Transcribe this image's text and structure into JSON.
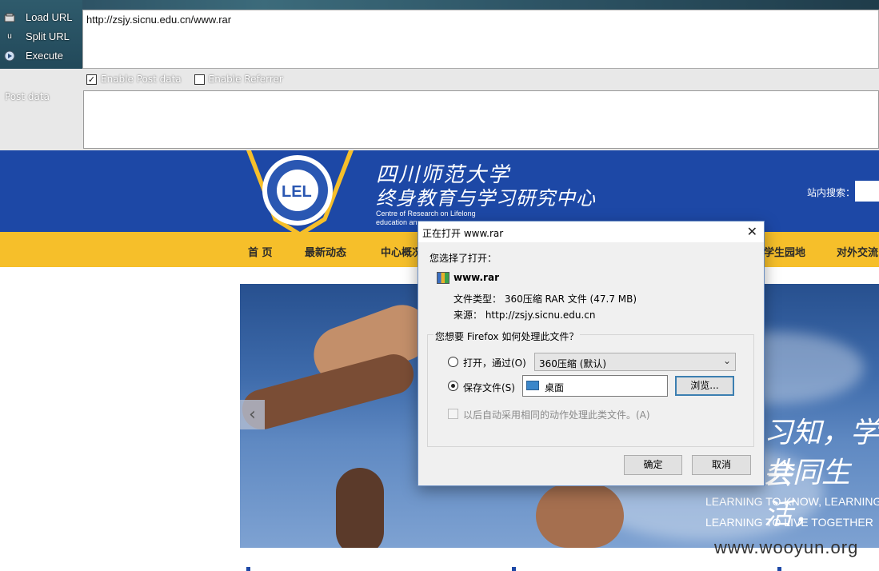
{
  "hackbar": {
    "load_url": "Load URL",
    "split_url": "Split URL",
    "execute": "Execute",
    "url_value": "http://zsjy.sicnu.edu.cn/www.rar",
    "enable_post": "Enable Post data",
    "enable_referrer": "Enable Referrer",
    "post_label": "Post data"
  },
  "site": {
    "title_cn": "四川师范大学",
    "subtitle_cn": "终身教育与学习研究中心",
    "en_line1": "Centre of  Research on  Lifelong",
    "en_line2": "education an",
    "search_label": "站内搜索：",
    "nav": [
      "首 页",
      "最新动态",
      "中心概况",
      "学生园地",
      "对外交流"
    ],
    "slogan_cn1": "习知，学会",
    "slogan_cn2": "共同生活，",
    "slogan_en1": "LEARNING TO KNOW, LEARNING",
    "slogan_en2": "LEARNING TO LIVE TOGETHER",
    "watermark": "www.wooyun.org"
  },
  "dialog": {
    "title": "正在打开 www.rar",
    "you_chose": "您选择了打开：",
    "filename": "www.rar",
    "filetype": "文件类型：  360压缩 RAR 文件 (47.7 MB)",
    "source": "来源：  http://zsjy.sicnu.edu.cn",
    "question": "您想要 Firefox 如何处理此文件？",
    "open_with": "打开，通过(O)",
    "open_with_app": "360压缩 (默认)",
    "save_file": "保存文件(S)",
    "save_location": "桌面",
    "browse": "浏览...",
    "auto_do": "以后自动采用相同的动作处理此类文件。(A)",
    "ok": "确定",
    "cancel": "取消"
  }
}
